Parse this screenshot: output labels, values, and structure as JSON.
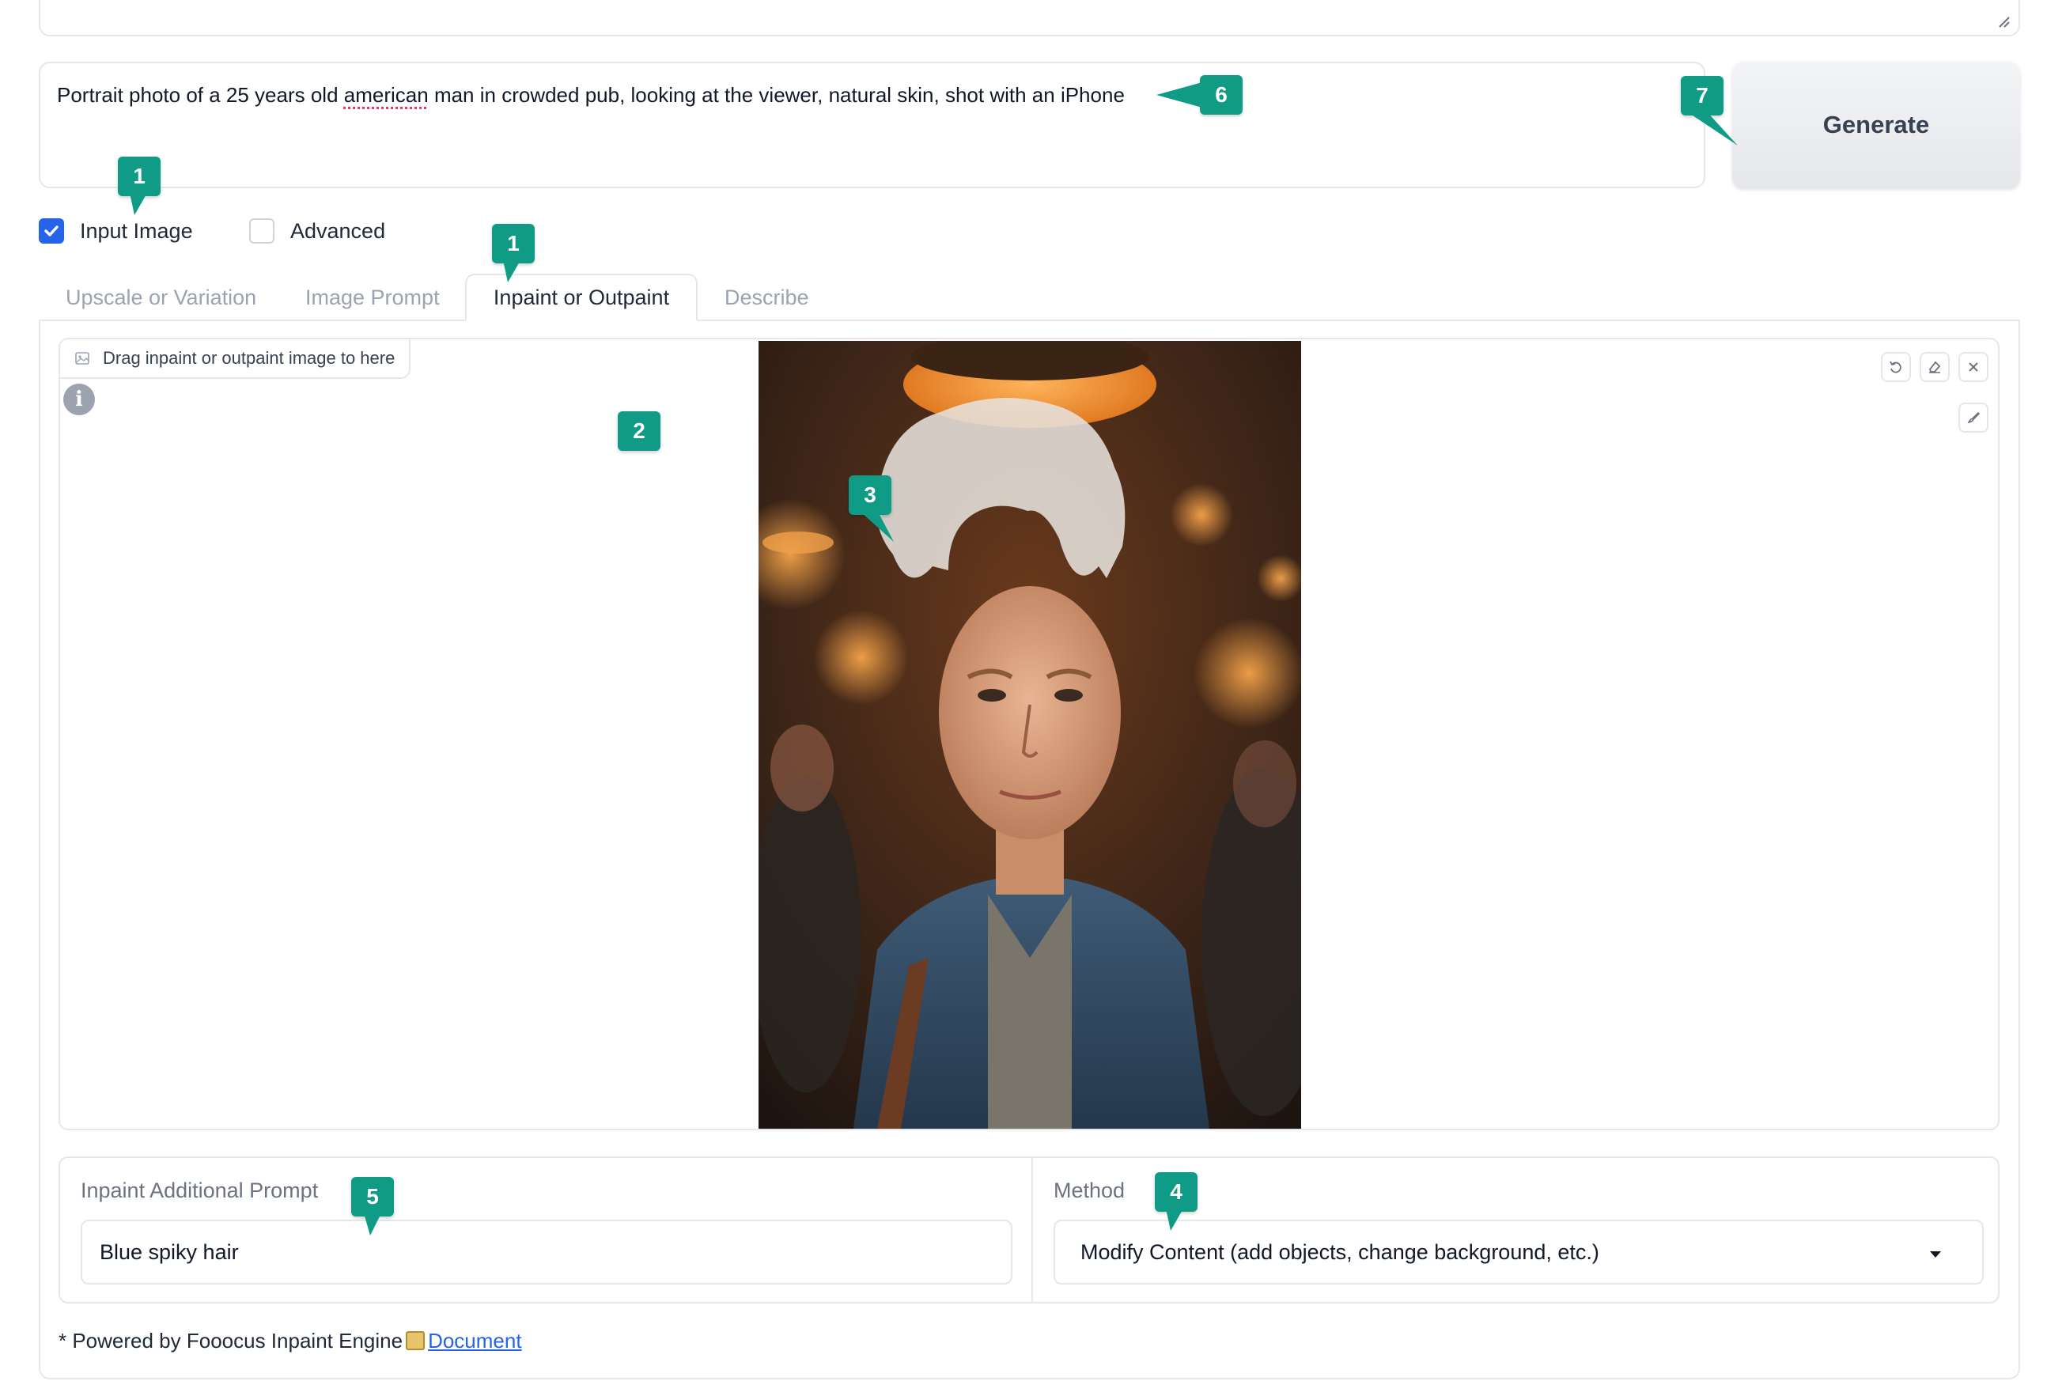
{
  "prompt": {
    "before_spell": "Portrait photo of a 25 years old ",
    "spell_word": "american",
    "after_spell": " man in crowded pub, looking at the viewer, natural skin, shot with an iPhone"
  },
  "generate_label": "Generate",
  "checkboxes": {
    "input_image": {
      "label": "Input Image",
      "checked": true
    },
    "advanced": {
      "label": "Advanced",
      "checked": false
    }
  },
  "tabs": [
    {
      "label": "Upscale or Variation",
      "active": false
    },
    {
      "label": "Image Prompt",
      "active": false
    },
    {
      "label": "Inpaint or Outpaint",
      "active": true
    },
    {
      "label": "Describe",
      "active": false
    }
  ],
  "canvas": {
    "drag_label": "Drag inpaint or outpaint image to here",
    "info_icon_char": "i"
  },
  "inpaint_prompt": {
    "label": "Inpaint Additional Prompt",
    "value": "Blue spiky hair"
  },
  "method": {
    "label": "Method",
    "value": "Modify Content (add objects, change background, etc.)"
  },
  "footer": {
    "text": "* Powered by Fooocus Inpaint Engine",
    "link": "Document"
  },
  "callouts": {
    "c1a": "1",
    "c1b": "1",
    "c2": "2",
    "c3": "3",
    "c4": "4",
    "c5": "5",
    "c6": "6",
    "c7": "7"
  },
  "colors": {
    "accent": "#2563eb",
    "callout": "#0f9b85",
    "border": "#e5e7eb"
  }
}
